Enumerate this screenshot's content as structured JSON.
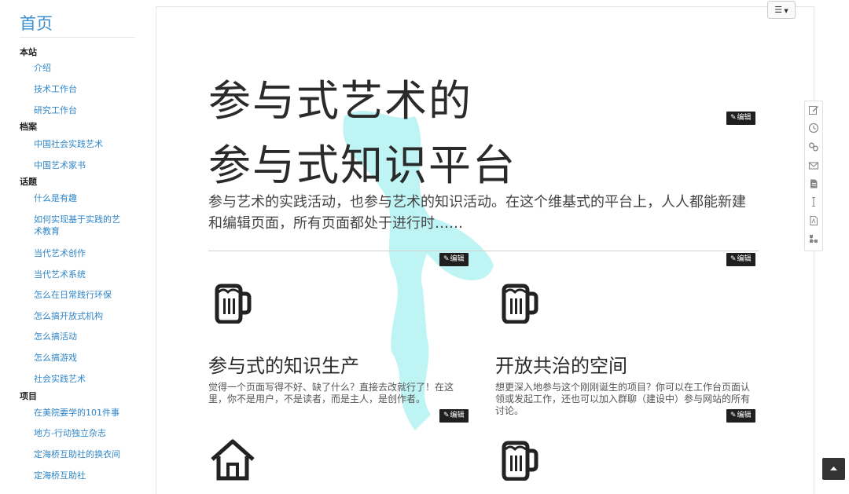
{
  "sidebar": {
    "home": "首页",
    "items": [
      {
        "type": "section",
        "label": "本站"
      },
      {
        "type": "link",
        "label": "介绍"
      },
      {
        "type": "link",
        "label": "技术工作台"
      },
      {
        "type": "link",
        "label": "研究工作台"
      },
      {
        "type": "section",
        "label": "档案"
      },
      {
        "type": "link",
        "label": "中国社会实践艺术"
      },
      {
        "type": "link",
        "label": "中国艺术家书"
      },
      {
        "type": "section",
        "label": "话题"
      },
      {
        "type": "link",
        "label": "什么是有趣"
      },
      {
        "type": "link",
        "label": "如何实现基于实践的艺术教育"
      },
      {
        "type": "link",
        "label": "当代艺术创作"
      },
      {
        "type": "link",
        "label": "当代艺术系统"
      },
      {
        "type": "link",
        "label": "怎么在日常践行环保"
      },
      {
        "type": "link",
        "label": "怎么搞开放式机构"
      },
      {
        "type": "link",
        "label": "怎么搞活动"
      },
      {
        "type": "link",
        "label": "怎么搞游戏"
      },
      {
        "type": "link",
        "label": "社会实践艺术"
      },
      {
        "type": "section",
        "label": "项目"
      },
      {
        "type": "link",
        "label": "在美院要学的101件事"
      },
      {
        "type": "link",
        "label": "地方-行动独立杂志"
      },
      {
        "type": "link",
        "label": "定海桥互助社的换衣间"
      },
      {
        "type": "link",
        "label": "定海桥互助社"
      }
    ]
  },
  "toolbar": {
    "toc_icon": "list-icon"
  },
  "edit_label": "编辑",
  "hero": {
    "line1": "参与式艺术的",
    "line2": "参与式知识平台",
    "description": "参与艺术的实践活动，也参与艺术的知识活动。在这个维基式的平台上，人人都能新建和编辑页面，所有页面都处于进行时……"
  },
  "cards": [
    {
      "icon": "beer-mug-icon",
      "title": "参与式的知识生产",
      "text": "觉得一个页面写得不好、缺了什么？直接去改就行了！在这里，你不是用户，不是读者，而是主人，是创作者。"
    },
    {
      "icon": "beer-mug-icon",
      "title": "开放共治的空间",
      "text": "想更深入地参与这个刚刚诞生的项目？你可以在工作台页面认领或发起工作，还也可以加入群聊（建设中）参与网站的所有讨论。"
    },
    {
      "icon": "home-icon",
      "title": "",
      "text": ""
    },
    {
      "icon": "beer-mug-icon",
      "title": "",
      "text": ""
    }
  ],
  "right_tools": [
    "edit-icon",
    "history-icon",
    "link-icon",
    "mail-icon",
    "file-icon",
    "text-cursor-icon",
    "pdf-icon",
    "sitemap-icon"
  ],
  "colors": {
    "link": "#2f86c9",
    "decor": "#b9f3f3",
    "edit_bg": "#1f1f1f"
  }
}
